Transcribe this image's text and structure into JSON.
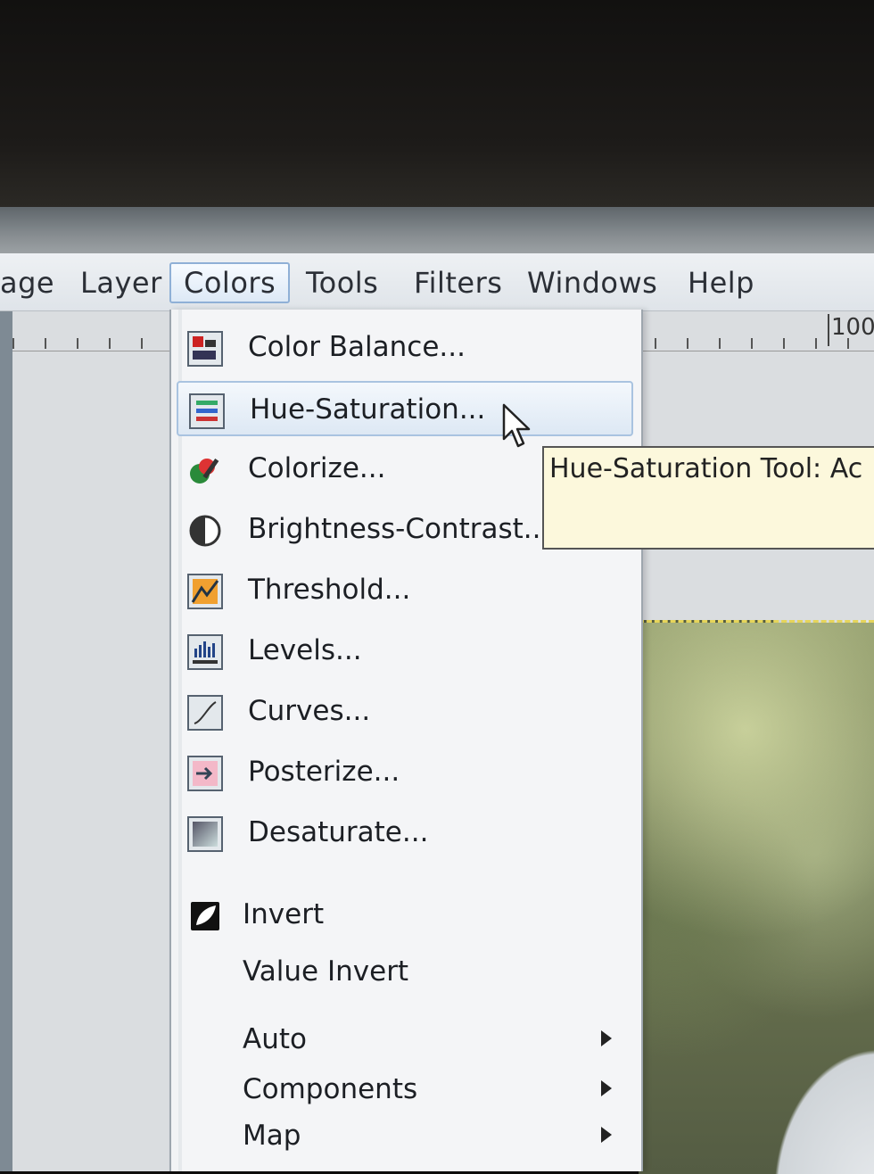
{
  "menubar": {
    "items": [
      "age",
      "Layer",
      "Colors",
      "Tools",
      "Filters",
      "Windows",
      "Help"
    ]
  },
  "ruler": {
    "label": "100"
  },
  "colors_menu": {
    "items": [
      {
        "label": "Color Balance...",
        "icon": "color-balance-icon"
      },
      {
        "label": "Hue-Saturation...",
        "icon": "hue-saturation-icon"
      },
      {
        "label": "Colorize...",
        "icon": "colorize-icon"
      },
      {
        "label": "Brightness-Contrast...",
        "icon": "brightness-contrast-icon"
      },
      {
        "label": "Threshold...",
        "icon": "threshold-icon"
      },
      {
        "label": "Levels...",
        "icon": "levels-icon"
      },
      {
        "label": "Curves...",
        "icon": "curves-icon"
      },
      {
        "label": "Posterize...",
        "icon": "posterize-icon"
      },
      {
        "label": "Desaturate...",
        "icon": "desaturate-icon"
      },
      {
        "label": "Invert",
        "icon": "invert-icon"
      },
      {
        "label": "Value Invert"
      },
      {
        "label": "Auto"
      },
      {
        "label": "Components"
      },
      {
        "label": "Map"
      }
    ],
    "highlighted": "Hue-Saturation..."
  },
  "tooltip": {
    "text": "Hue-Saturation Tool: Ac"
  },
  "colors": {
    "highlight_border": "#a9c3e0",
    "tooltip_bg": "#fcf8dc",
    "menubar_active_border": "#8fb0d6"
  }
}
